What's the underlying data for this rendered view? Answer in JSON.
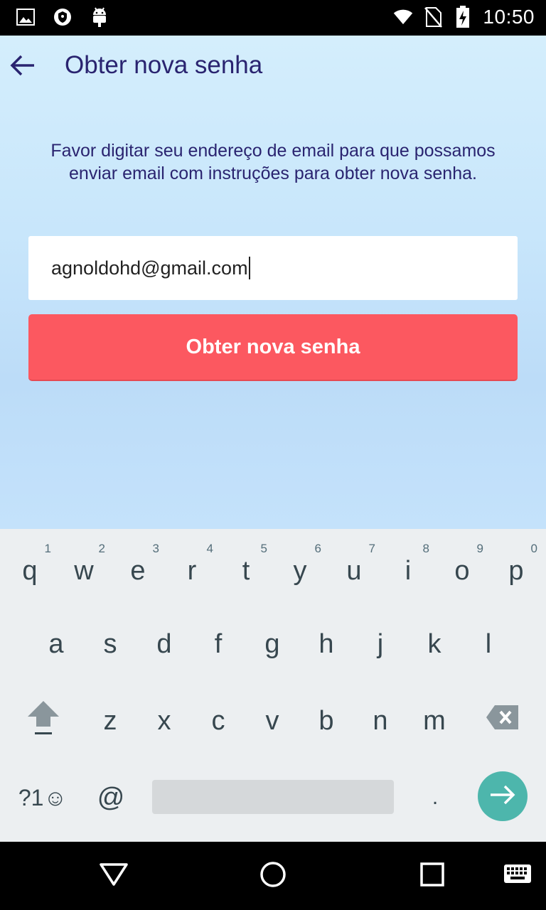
{
  "status_bar": {
    "time": "10:50",
    "left_icons": [
      "image-icon",
      "shield-icon",
      "android-icon"
    ],
    "right_icons": [
      "wifi-icon",
      "no-sim-icon",
      "battery-charging-icon"
    ]
  },
  "app_bar": {
    "title": "Obter nova senha",
    "back_icon": "arrow-back-icon"
  },
  "description": "Favor digitar seu endereço de email para que possamos enviar email com instruções para obter nova senha.",
  "email_field": {
    "value": "agnoldohd@gmail.com"
  },
  "submit_button": {
    "label": "Obter nova senha"
  },
  "colors": {
    "accent": "#fc5860",
    "title": "#2a2470",
    "enter_key": "#4db6ac"
  },
  "keyboard": {
    "row1": [
      {
        "key": "q",
        "hint": "1"
      },
      {
        "key": "w",
        "hint": "2"
      },
      {
        "key": "e",
        "hint": "3"
      },
      {
        "key": "r",
        "hint": "4"
      },
      {
        "key": "t",
        "hint": "5"
      },
      {
        "key": "y",
        "hint": "6"
      },
      {
        "key": "u",
        "hint": "7"
      },
      {
        "key": "i",
        "hint": "8"
      },
      {
        "key": "o",
        "hint": "9"
      },
      {
        "key": "p",
        "hint": "0"
      }
    ],
    "row2": [
      "a",
      "s",
      "d",
      "f",
      "g",
      "h",
      "j",
      "k",
      "l"
    ],
    "row3": [
      "z",
      "x",
      "c",
      "v",
      "b",
      "n",
      "m"
    ],
    "symbols_key": "?1☺",
    "at_key": "@",
    "period_key": ".",
    "shift_icon": "shift-icon",
    "backspace_icon": "backspace-icon",
    "enter_icon": "arrow-forward-icon"
  },
  "nav_bar": {
    "icons": [
      "back-triangle-icon",
      "home-circle-icon",
      "recents-square-icon",
      "keyboard-icon"
    ]
  }
}
